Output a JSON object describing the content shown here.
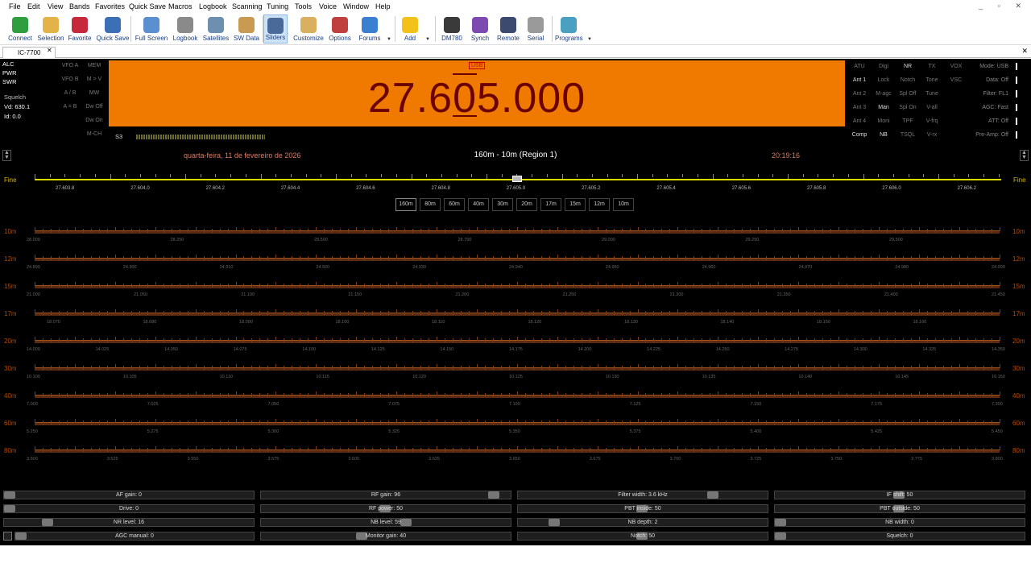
{
  "menu": [
    "File",
    "Edit",
    "View",
    "Bands",
    "Favorites",
    "Quick Save",
    "Macros",
    "Logbook",
    "Scanning",
    "Tuning",
    "Tools",
    "Voice",
    "Window",
    "Help"
  ],
  "toolbar": [
    {
      "label": "Connect",
      "icon": "connect-icon",
      "color": "#2e9e3e"
    },
    {
      "label": "Selection",
      "icon": "folder-icon",
      "color": "#e3b34a"
    },
    {
      "label": "Favorite",
      "icon": "heart-icon",
      "color": "#c8283c"
    },
    {
      "label": "Quick Save",
      "icon": "save-icon",
      "color": "#3b6fb6"
    },
    {
      "label": "Full Screen",
      "icon": "fullscreen-icon",
      "color": "#5a8fd0"
    },
    {
      "label": "Logbook",
      "icon": "logbook-icon",
      "color": "#8a8a8a"
    },
    {
      "label": "Satellites",
      "icon": "satellite-icon",
      "color": "#6e8fb0"
    },
    {
      "label": "SW Data",
      "icon": "sw-data-icon",
      "color": "#c89a52"
    },
    {
      "label": "Sliders",
      "icon": "sliders-icon",
      "color": "#4a6a9a"
    },
    {
      "label": "Customize",
      "icon": "customize-icon",
      "color": "#d9b060"
    },
    {
      "label": "Options",
      "icon": "options-icon",
      "color": "#c04040"
    },
    {
      "label": "Forums",
      "icon": "forums-icon",
      "color": "#3a7fd0"
    },
    {
      "label": "Add",
      "icon": "star-icon",
      "color": "#f2c21b"
    },
    {
      "label": "DM780",
      "icon": "dm780-icon",
      "color": "#3a3a3a"
    },
    {
      "label": "Synch",
      "icon": "synch-icon",
      "color": "#7c4ab0"
    },
    {
      "label": "Remote",
      "icon": "remote-icon",
      "color": "#3c4a70"
    },
    {
      "label": "Serial",
      "icon": "serial-icon",
      "color": "#9a9a9a"
    },
    {
      "label": "Programs",
      "icon": "programs-icon",
      "color": "#4aa0c0"
    }
  ],
  "tab": {
    "label": "IC-7700"
  },
  "meters": {
    "alc": "ALC",
    "pwr": "PWR",
    "swr": "SWR",
    "squelch": "Squelch",
    "vd": "Vd: 630.1",
    "id": "Id: 0.0"
  },
  "vfo_left": [
    [
      "VFO A",
      "MEM"
    ],
    [
      "VFO B",
      "M > V"
    ],
    [
      "A / B",
      "MW"
    ],
    [
      "A = B",
      "Dw Off"
    ],
    [
      "",
      "Dw On"
    ],
    [
      "",
      "M-CH"
    ]
  ],
  "s_meter": "S3",
  "display": {
    "mode": "USB",
    "freq_pre": "27.6",
    "freq_digit": "0",
    "freq_post": "5.000"
  },
  "right_buttons": [
    [
      "ATU",
      "Digi",
      "NR",
      "TX",
      "VOX"
    ],
    [
      "Ant 1",
      "Lock",
      "Notch",
      "Tone",
      "VSC"
    ],
    [
      "Ant 2",
      "M-agc",
      "Spl Off",
      "Tune",
      ""
    ],
    [
      "Ant 3",
      "Man",
      "Spl On",
      "V-all",
      ""
    ],
    [
      "Ant 4",
      "Moni",
      "TPF",
      "V-frq",
      ""
    ],
    [
      "Comp",
      "NB",
      "TSQL",
      "V-rx",
      ""
    ]
  ],
  "status": [
    "Mode: USB",
    "Data: Off",
    "Filter: FL1",
    "AGC: Fast",
    "ATT: Off",
    "Pre-Amp: Off"
  ],
  "date": "quarta-feira, 11 de fevereiro de 2026",
  "band_range": "160m - 10m (Region 1)",
  "time": "20:19:16",
  "fine_label": "Fine",
  "tuning_ticks": [
    "27.603.8",
    "27.604.0",
    "27.604.2",
    "27.604.4",
    "27.604.6",
    "27.604.8",
    "27.605.0",
    "27.605.2",
    "27.605.4",
    "27.605.6",
    "27.605.8",
    "27.606.0",
    "27.606.2"
  ],
  "band_buttons": [
    "160m",
    "80m",
    "60m",
    "40m",
    "30m",
    "20m",
    "17m",
    "15m",
    "12m",
    "10m"
  ],
  "bands": [
    {
      "name": "10m",
      "ticks": [
        "28.000",
        "28.250",
        "28.500",
        "28.750",
        "29.000",
        "29.250",
        "29.500"
      ]
    },
    {
      "name": "12m",
      "ticks": [
        "24.890",
        "24.900",
        "24.910",
        "24.920",
        "24.930",
        "24.940",
        "24.950",
        "24.960",
        "24.970",
        "24.980",
        "24.990"
      ]
    },
    {
      "name": "15m",
      "ticks": [
        "21.000",
        "21.050",
        "21.100",
        "21.150",
        "21.200",
        "21.250",
        "21.300",
        "21.350",
        "21.400",
        "21.450"
      ]
    },
    {
      "name": "17m",
      "ticks": [
        "18.070",
        "18.080",
        "18.090",
        "18.100",
        "18.110",
        "18.120",
        "18.130",
        "18.140",
        "18.150",
        "18.160"
      ]
    },
    {
      "name": "20m",
      "ticks": [
        "14.000",
        "14.025",
        "14.050",
        "14.075",
        "14.100",
        "14.125",
        "14.150",
        "14.175",
        "14.200",
        "14.225",
        "14.250",
        "14.275",
        "14.300",
        "14.325",
        "14.350"
      ]
    },
    {
      "name": "30m",
      "ticks": [
        "10.100",
        "10.105",
        "10.110",
        "10.115",
        "10.120",
        "10.125",
        "10.130",
        "10.135",
        "10.140",
        "10.145",
        "10.150"
      ]
    },
    {
      "name": "40m",
      "ticks": [
        "7.000",
        "7.025",
        "7.050",
        "7.075",
        "7.100",
        "7.125",
        "7.150",
        "7.175",
        "7.200"
      ]
    },
    {
      "name": "60m",
      "ticks": [
        "5.250",
        "5.275",
        "5.300",
        "5.325",
        "5.350",
        "5.375",
        "5.400",
        "5.425",
        "5.450"
      ]
    },
    {
      "name": "80m",
      "ticks": [
        "3.500",
        "3.525",
        "3.550",
        "3.575",
        "3.600",
        "3.625",
        "3.650",
        "3.675",
        "3.700",
        "3.725",
        "3.750",
        "3.775",
        "3.800"
      ]
    }
  ],
  "sliders": [
    [
      "AF gain: 0",
      "RF gain: 96",
      "Filter width: 3.6 kHz",
      "IF shift: 50"
    ],
    [
      "Drive: 0",
      "RF power: 50",
      "PBT inside: 50",
      "PBT outside: 50"
    ],
    [
      "NR level: 16",
      "NB level: 59",
      "NB depth: 2",
      "NB width: 0"
    ],
    [
      "AGC manual: 0",
      "Monitor gain: 40",
      "Notch: 50",
      "Squelch: 0"
    ]
  ],
  "slider_levels": [
    [
      0,
      96,
      80,
      50
    ],
    [
      0,
      50,
      50,
      50
    ],
    [
      16,
      59,
      13,
      0
    ],
    [
      0,
      40,
      50,
      0
    ]
  ]
}
